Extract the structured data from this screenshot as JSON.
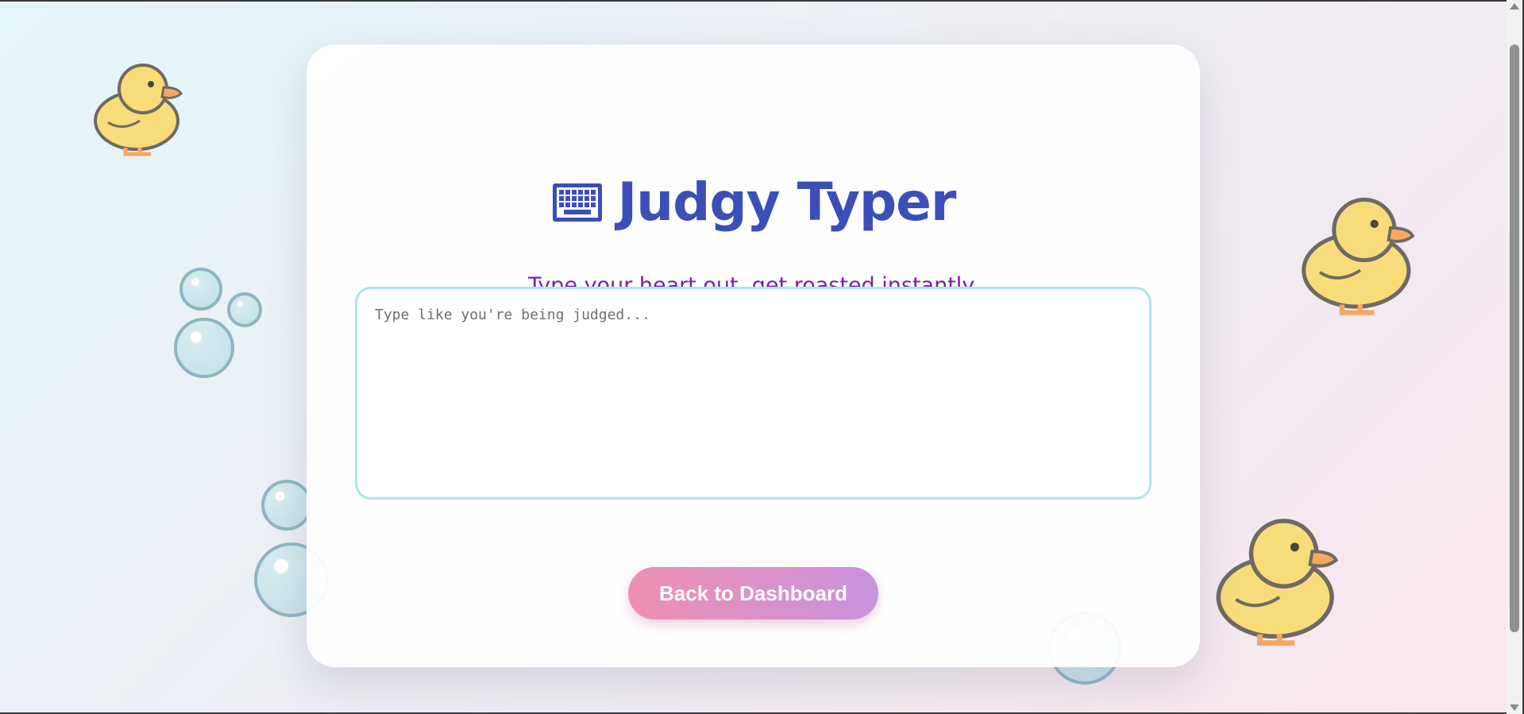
{
  "app": {
    "title": "Judgy Typer",
    "subtitle": "Type your heart out, get roasted instantly."
  },
  "editor": {
    "placeholder": "Type like you're being judged...",
    "value": ""
  },
  "actions": {
    "back_label": "Back to Dashboard"
  },
  "icons": {
    "title_icon": "keyboard-icon",
    "decorations": [
      "rubber-duck-icon",
      "bubble-icon"
    ]
  },
  "colors": {
    "title": "#3a4fb8",
    "subtitle": "#7b1fa2",
    "textarea_border": "#aee3ea",
    "button_gradient_start": "#ef8fb1",
    "button_gradient_end": "#c993dd"
  }
}
